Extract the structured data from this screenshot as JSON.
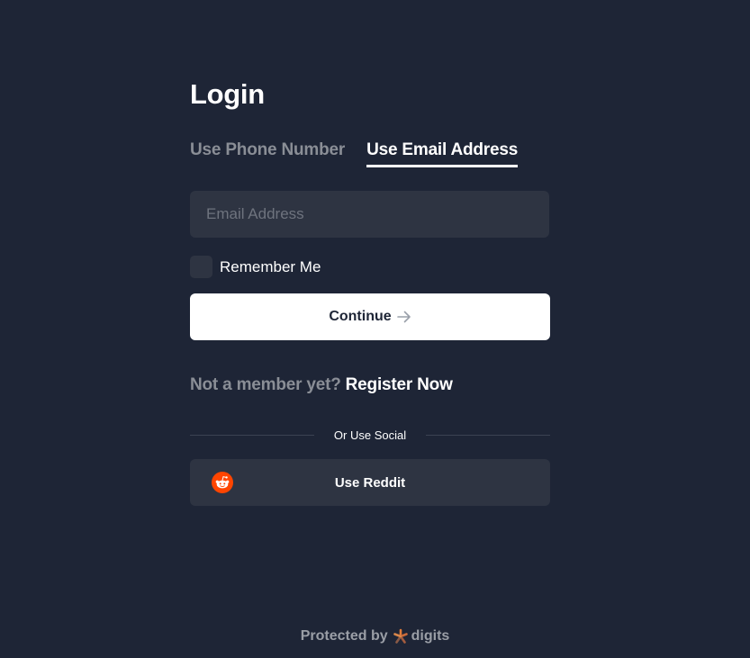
{
  "login": {
    "title": "Login",
    "tabs": [
      {
        "label": "Use Phone Number",
        "active": false
      },
      {
        "label": "Use Email Address",
        "active": true
      }
    ],
    "email": {
      "placeholder": "Email Address",
      "value": ""
    },
    "remember_me": {
      "label": "Remember Me",
      "checked": false
    },
    "continue_label": "Continue",
    "register": {
      "prompt": "Not a member yet?",
      "link": "Register Now"
    },
    "divider_text": "Or Use Social",
    "social": {
      "reddit_label": "Use Reddit",
      "reddit_icon": "reddit-icon",
      "reddit_color": "#ff4500"
    }
  },
  "footer": {
    "protected_by": "Protected by",
    "brand": "digits",
    "brand_icon": "digits-star-icon"
  },
  "colors": {
    "background": "#1e2536",
    "field_background": "#2e3442",
    "muted_text": "#8a8e96",
    "primary_button": "#ffffff"
  },
  "icons": {
    "continue_arrow": "arrow-right-icon"
  }
}
